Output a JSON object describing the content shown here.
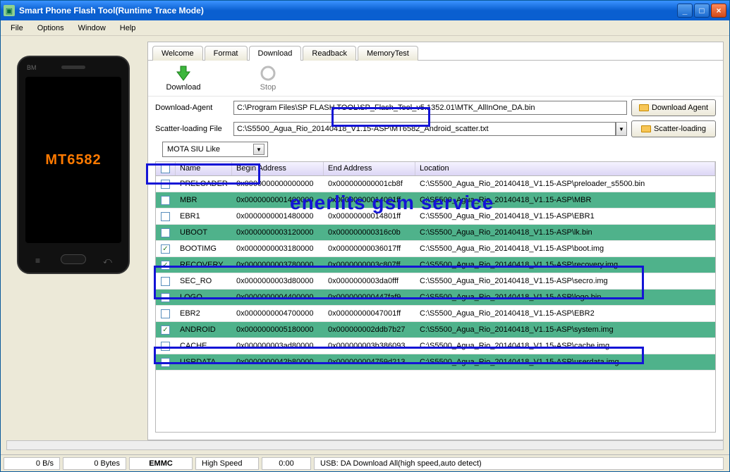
{
  "window": {
    "title": "Smart Phone Flash Tool(Runtime Trace Mode)"
  },
  "menu": {
    "file": "File",
    "options": "Options",
    "window": "Window",
    "help": "Help"
  },
  "phone": {
    "model": "MT6582",
    "brand": "BM"
  },
  "tabs": {
    "welcome": "Welcome",
    "format": "Format",
    "download": "Download",
    "readback": "Readback",
    "memorytest": "MemoryTest"
  },
  "toolbar": {
    "download": "Download",
    "stop": "Stop"
  },
  "form": {
    "da_label": "Download-Agent",
    "da_value": "C:\\Program Files\\SP FLASH TOOL\\SP_Flash_Tool_v5.1352.01\\MTK_AllInOne_DA.bin",
    "da_btn": "Download Agent",
    "scatter_label": "Scatter-loading File",
    "scatter_value": "C:\\S5500_Agua_Rio_20140418_V1.15-ASP\\MT6582_Android_scatter.txt",
    "scatter_btn": "Scatter-loading",
    "mode": "MOTA SIU Like"
  },
  "grid": {
    "headers": {
      "name": "Name",
      "begin": "Begin Address",
      "end": "End Address",
      "location": "Location"
    },
    "rows": [
      {
        "chk": false,
        "green": false,
        "name": "PRELOADER",
        "begin": "0x0000000000000000",
        "end": "0x000000000001cb8f",
        "loc": "C:\\S5500_Agua_Rio_20140418_V1.15-ASP\\preloader_s5500.bin"
      },
      {
        "chk": false,
        "green": true,
        "name": "MBR",
        "begin": "0x0000000001400000",
        "end": "0x00000000014001ff",
        "loc": "C:\\S5500_Agua_Rio_20140418_V1.15-ASP\\MBR"
      },
      {
        "chk": false,
        "green": false,
        "name": "EBR1",
        "begin": "0x0000000001480000",
        "end": "0x00000000014801ff",
        "loc": "C:\\S5500_Agua_Rio_20140418_V1.15-ASP\\EBR1"
      },
      {
        "chk": false,
        "green": true,
        "name": "UBOOT",
        "begin": "0x0000000003120000",
        "end": "0x000000000316c0b",
        "loc": "C:\\S5500_Agua_Rio_20140418_V1.15-ASP\\lk.bin"
      },
      {
        "chk": true,
        "green": false,
        "name": "BOOTIMG",
        "begin": "0x0000000003180000",
        "end": "0x00000000036017ff",
        "loc": "C:\\S5500_Agua_Rio_20140418_V1.15-ASP\\boot.img"
      },
      {
        "chk": true,
        "green": true,
        "name": "RECOVERY",
        "begin": "0x0000000003780000",
        "end": "0x0000000003c807ff",
        "loc": "C:\\S5500_Agua_Rio_20140418_V1.15-ASP\\recovery.img"
      },
      {
        "chk": false,
        "green": false,
        "name": "SEC_RO",
        "begin": "0x0000000003d80000",
        "end": "0x0000000003da0fff",
        "loc": "C:\\S5500_Agua_Rio_20140418_V1.15-ASP\\secro.img"
      },
      {
        "chk": false,
        "green": true,
        "name": "LOGO",
        "begin": "0x0000000004400000",
        "end": "0x000000000447faf9",
        "loc": "C:\\S5500_Agua_Rio_20140418_V1.15-ASP\\logo.bin"
      },
      {
        "chk": false,
        "green": false,
        "name": "EBR2",
        "begin": "0x0000000004700000",
        "end": "0x00000000047001ff",
        "loc": "C:\\S5500_Agua_Rio_20140418_V1.15-ASP\\EBR2"
      },
      {
        "chk": true,
        "green": true,
        "name": "ANDROID",
        "begin": "0x0000000005180000",
        "end": "0x000000002ddb7b27",
        "loc": "C:\\S5500_Agua_Rio_20140418_V1.15-ASP\\system.img"
      },
      {
        "chk": false,
        "green": false,
        "name": "CACHE",
        "begin": "0x000000003ad80000",
        "end": "0x000000003b386093",
        "loc": "C:\\S5500_Agua_Rio_20140418_V1.15-ASP\\cache.img"
      },
      {
        "chk": false,
        "green": true,
        "name": "USRDATA",
        "begin": "0x0000000042b80000",
        "end": "0x000000004759d213",
        "loc": "C:\\S5500_Agua_Rio_20140418_V1.15-ASP\\userdata.img"
      }
    ]
  },
  "status": {
    "speed": "0 B/s",
    "bytes": "0 Bytes",
    "storage": "EMMC",
    "mode": "High Speed",
    "time": "0:00",
    "usb": "USB: DA Download All(high speed,auto detect)"
  },
  "annotation": {
    "watermark": "enerlits gsm service"
  }
}
